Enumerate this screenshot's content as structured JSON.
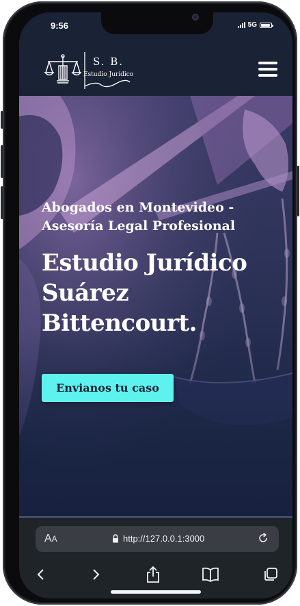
{
  "status_bar": {
    "time": "9:56",
    "network": "5G",
    "battery_level": 0.9
  },
  "site": {
    "logo_initials": "S. B.",
    "logo_subtitle": "Estudio Jurídico",
    "logo_icon": "scales-of-justice-icon",
    "menu_icon": "hamburger-menu-icon"
  },
  "hero": {
    "subtitle": "Abogados en Montevideo - Asesoría Legal Profesional",
    "title": "Estudio Jurídico Suárez Bittencourt.",
    "cta_label": "Envianos tu caso",
    "image": "lady-justice-statue-scales"
  },
  "browser": {
    "text_size_label_large": "A",
    "text_size_label_small": "A",
    "url": "http://127.0.0.1:3000",
    "toolbar_icons": [
      "back-icon",
      "forward-icon",
      "share-icon",
      "bookmarks-icon",
      "tabs-icon"
    ]
  },
  "colors": {
    "nav_bg": "#1a2236",
    "hero_bg": "#1c2746",
    "cta_bg": "#5ef2ee",
    "browser_bg": "#1f2429"
  }
}
